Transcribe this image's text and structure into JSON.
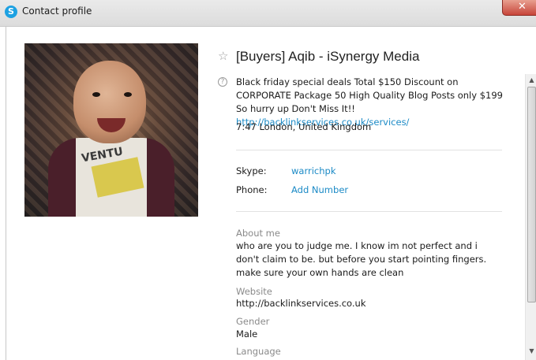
{
  "window": {
    "title": "Contact profile",
    "app_icon_letter": "S",
    "close_glyph": "✕"
  },
  "profile": {
    "name": "[Buyers] Aqib - iSynergy Media",
    "mood_text": "Black friday special deals Total $150 Discount on CORPORATE Package 50 High Quality Blog Posts only $199 So hurry up Don't Miss It!! ",
    "mood_link": "http://backlinkservices.co.uk/services/",
    "local_time": "7:47 London, United Kingdom",
    "avatar_shirt_text": "VENTU"
  },
  "fields": {
    "skype_label": "Skype:",
    "skype_value": "warrichpk",
    "phone_label": "Phone:",
    "phone_value": "Add Number"
  },
  "sections": {
    "about_label": "About me",
    "about_value": "who are you to judge me. I know im not perfect and i don't claim to be. but before you start pointing fingers. make sure your own hands are clean",
    "website_label": "Website",
    "website_value": "http://backlinkservices.co.uk",
    "gender_label": "Gender",
    "gender_value": "Male",
    "language_label": "Language"
  },
  "icons": {
    "star": "☆",
    "help": "?",
    "scroll_up": "▲",
    "scroll_down": "▼"
  },
  "colors": {
    "link": "#1b8ac6",
    "muted_label": "#8a8a8a",
    "skype_blue": "#1da1e2"
  }
}
